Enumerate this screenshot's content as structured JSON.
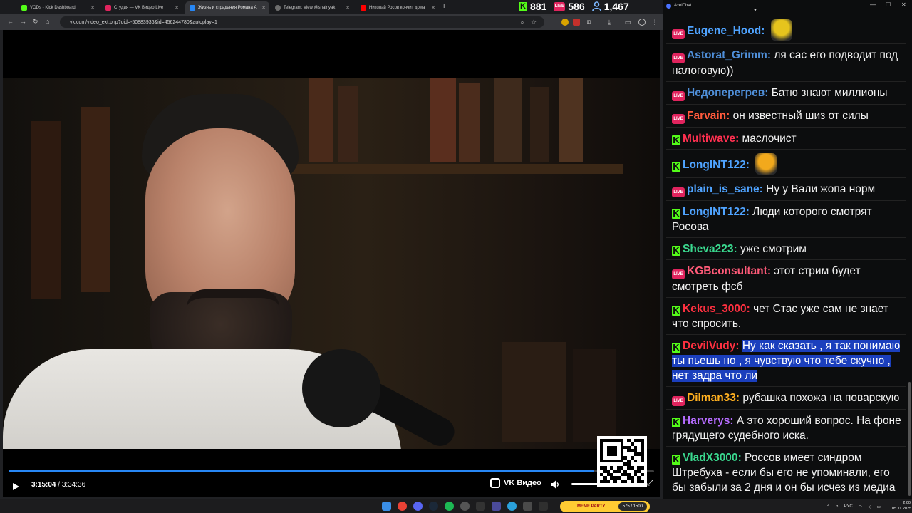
{
  "browser": {
    "tabs": [
      {
        "title": "VODs - Kick Dashboard",
        "active": false,
        "favicon_color": "#53fc18"
      },
      {
        "title": "Студия — VK Видео Live",
        "active": false,
        "favicon_color": "#e0245e"
      },
      {
        "title": "Жизнь и страдания Романа А",
        "active": true,
        "favicon_color": "#2787f5"
      },
      {
        "title": "Telegram: View @shalnyak",
        "active": false,
        "favicon_color": "#6d6d6d"
      },
      {
        "title": "Николай Росов кончит дома",
        "active": false,
        "favicon_color": "#ff0000"
      }
    ],
    "new_tab_label": "+",
    "url": "vk.com/video_ext.php?oid=-50883936&id=456244780&autoplay=1"
  },
  "stream_stats": {
    "kick_viewers": "881",
    "vk_viewers": "586",
    "total_viewers": "1,467",
    "kick_badge": "K",
    "live_badge": "LIVE"
  },
  "player": {
    "current_time": "3:15:04",
    "separator": "/",
    "duration": "3:34:36",
    "progress": 0.9078,
    "brand": "VK Видео",
    "volume_level": 0.5,
    "accent_color": "#2787f5"
  },
  "chat": {
    "window_title": "AxelChat",
    "messages": [
      {
        "platform": "live",
        "user": "Eugene_Hood",
        "text": "",
        "color": "#4fa3ff",
        "emote": "#e6c41d"
      },
      {
        "platform": "live",
        "user": "Astorat_Grimm",
        "text": "ля сас его подводит под налоговую))",
        "color": "#4f8fd9"
      },
      {
        "platform": "live",
        "user": "Недоперегрев",
        "text": "Батю знают миллионы",
        "color": "#4f8fd9"
      },
      {
        "platform": "live",
        "user": "Farvain",
        "text": "он известный шиз от силы",
        "color": "#ff5a3c"
      },
      {
        "platform": "kick",
        "user": "Multiwave",
        "text": "маслочист",
        "color": "#ff3050"
      },
      {
        "platform": "kick",
        "user": "LongINT122",
        "text": "",
        "color": "#4fa3ff",
        "emote": "#f2a91c"
      },
      {
        "platform": "live",
        "user": "plain_is_sane",
        "text": "Ну у Вали жопа норм",
        "color": "#4fa3ff"
      },
      {
        "platform": "kick",
        "user": "LongINT122",
        "text": "Люди которого смотрят Росова",
        "color": "#4fa3ff"
      },
      {
        "platform": "kick",
        "user": "Sheva223",
        "text": "уже смотрим",
        "color": "#3ad98f"
      },
      {
        "platform": "live",
        "user": "KGBconsultant",
        "text": "этот стрим будет смотреть фсб",
        "color": "#ff5a78"
      },
      {
        "platform": "kick",
        "user": "Kekus_3000",
        "text": "чет Стас уже сам не знает что спросить.",
        "color": "#ff3040"
      },
      {
        "platform": "kick",
        "user": "DevilVudy",
        "text": "Ну как сказать , я так понимаю ты пьешь но , я чувствую что тебе скучно , нет задра что ли",
        "color": "#ff3040",
        "highlight": true
      },
      {
        "platform": "live",
        "user": "Dilman33",
        "text": "рубашка похожа на поварскую",
        "color": "#ffb020"
      },
      {
        "platform": "kick",
        "user": "Harverys",
        "text": "А это хороший вопрос. На фоне грядущего судебного иска.",
        "color": "#b56cff"
      },
      {
        "platform": "kick",
        "user": "VladX3000",
        "text": "Россов имеет синдром Штребуха - если бы его не упоминали, его бы забыли за 2 дня и он бы исчез из медиа",
        "color": "#3ad98f"
      }
    ]
  },
  "taskbar": {
    "meme_label": "MEME PARTY",
    "meme_progress": "575 / 1500",
    "lang": "РУС",
    "time": "2:00",
    "date": "05.11.2025"
  }
}
